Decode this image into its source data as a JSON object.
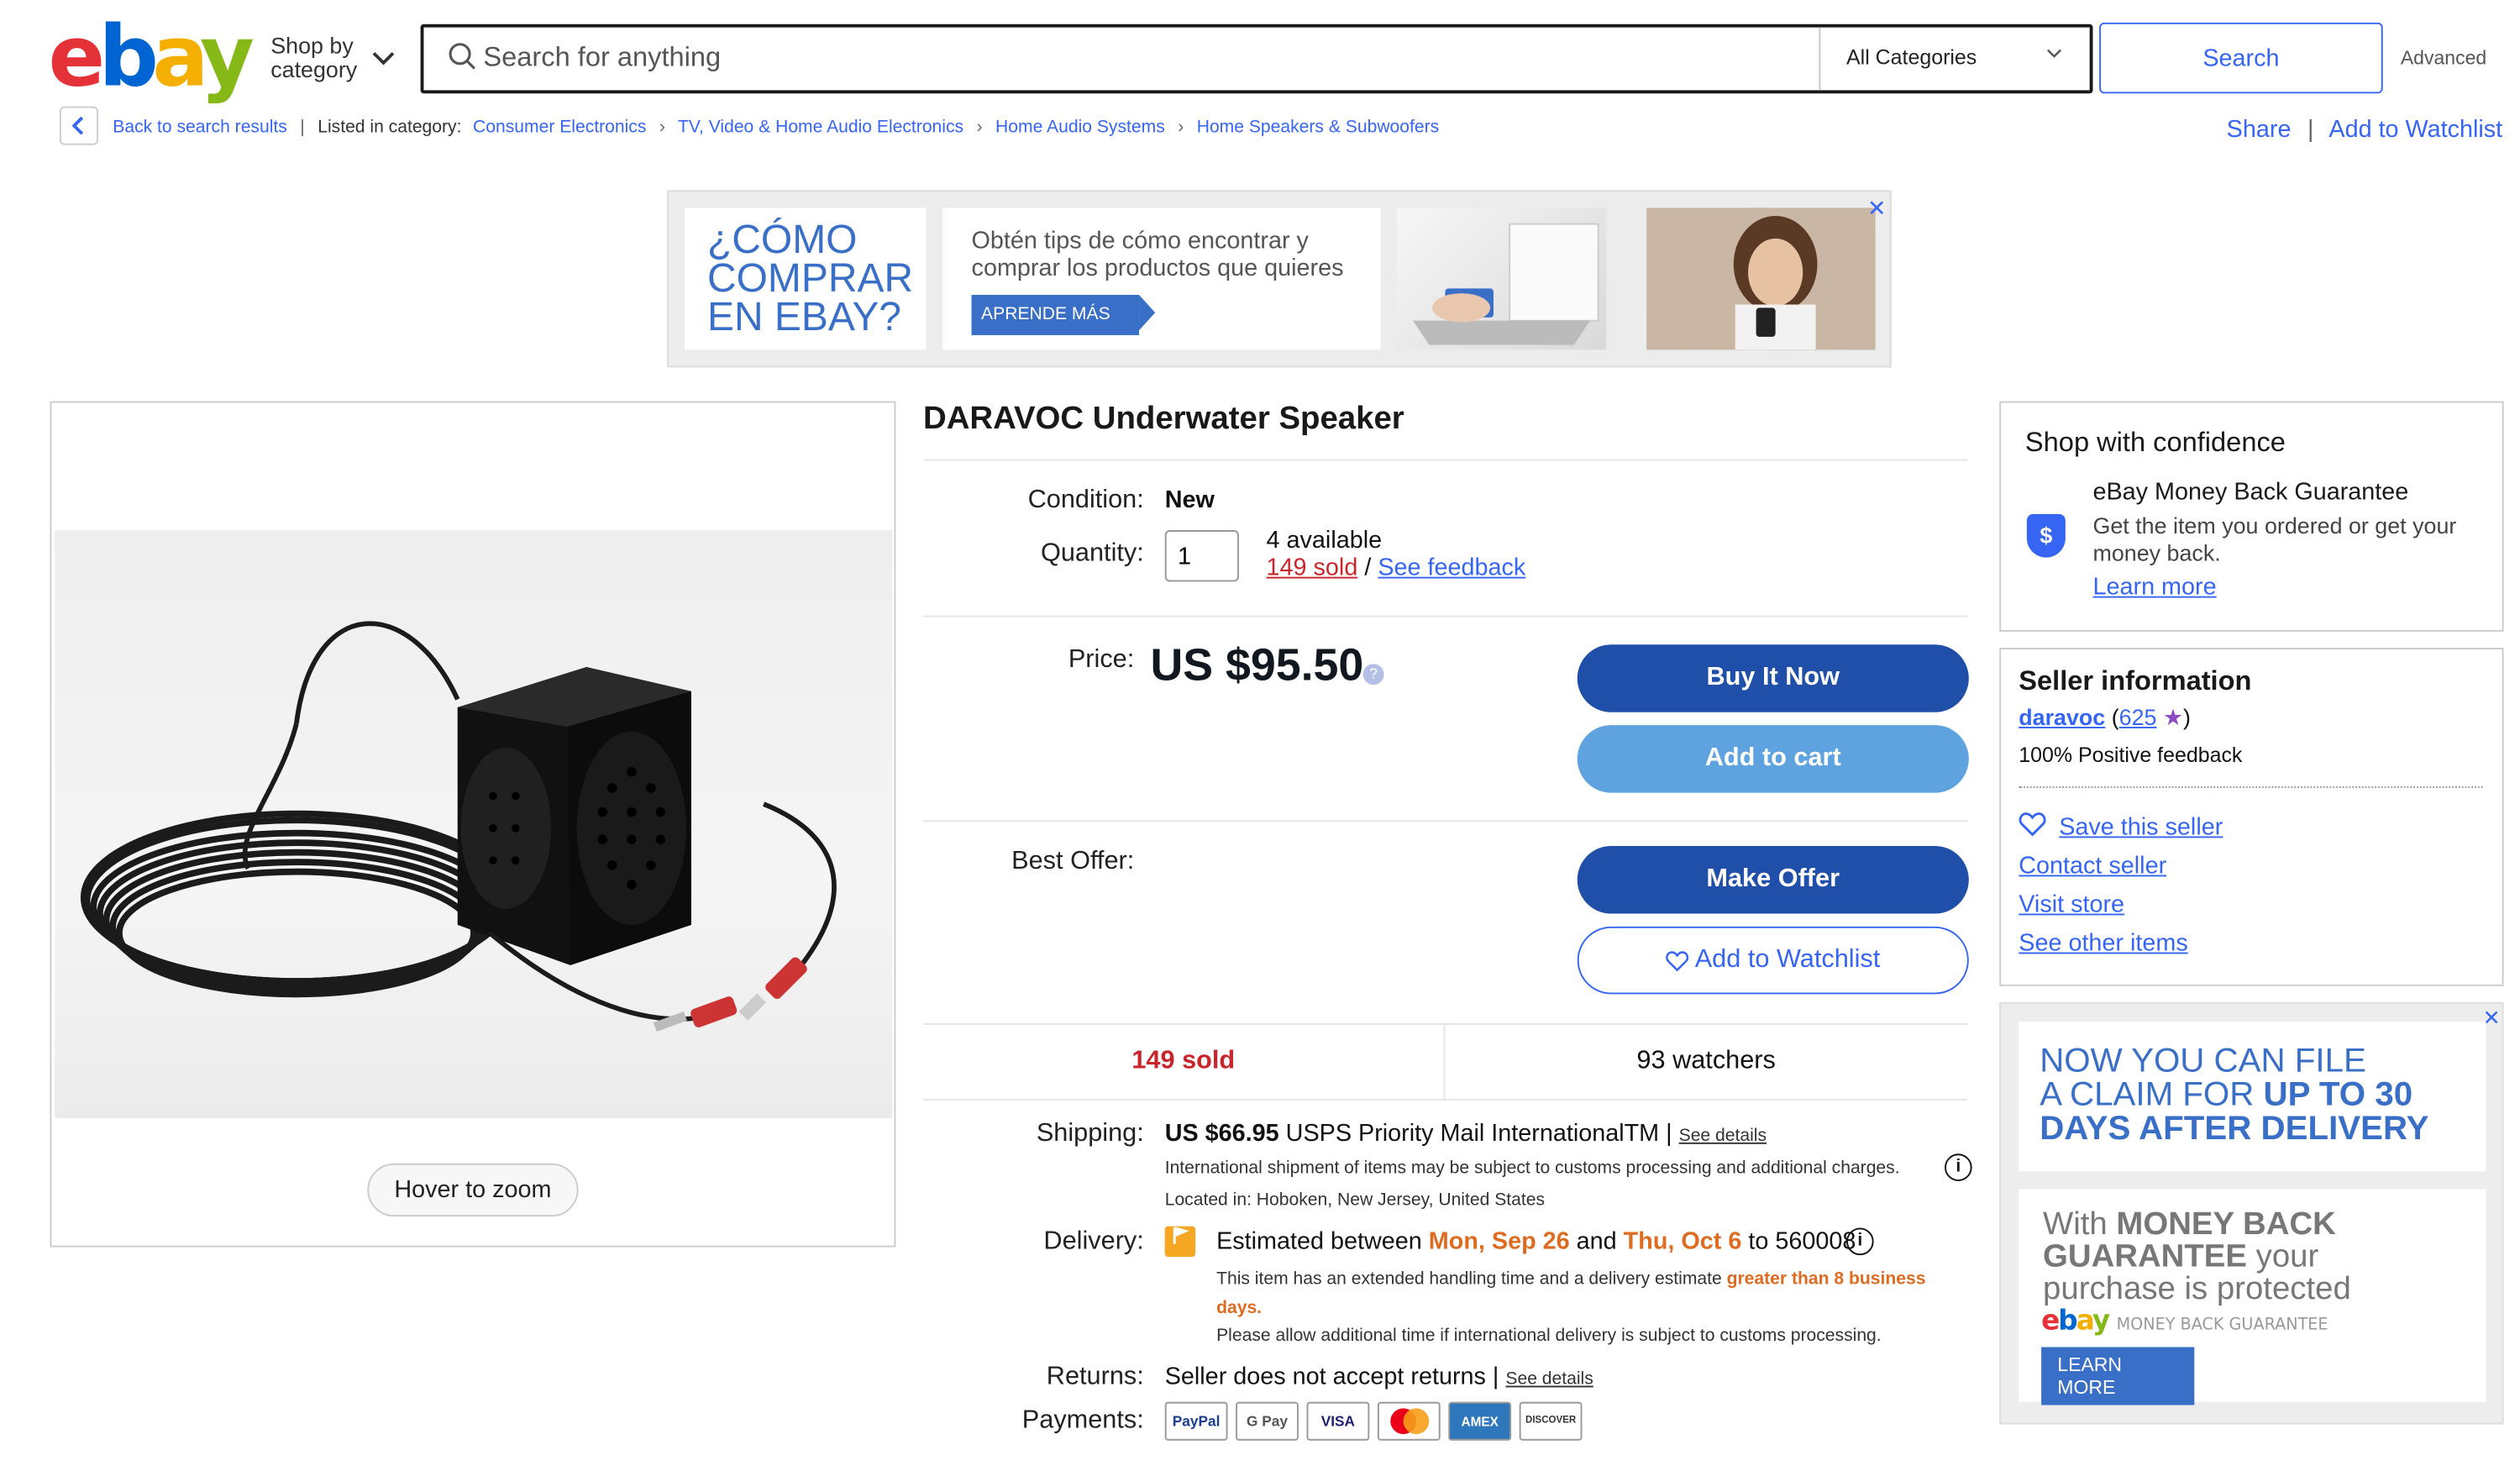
{
  "header": {
    "logo_letters": [
      "e",
      "b",
      "a",
      "y"
    ],
    "shop_by_category": "Shop by category",
    "search_placeholder": "Search for anything",
    "category_select": "All Categories",
    "search_button": "Search",
    "advanced": "Advanced"
  },
  "breadcrumb": {
    "back": "Back to search results",
    "listed_in": "Listed in category:",
    "items": [
      "Consumer Electronics",
      "TV, Video & Home Audio Electronics",
      "Home Audio Systems",
      "Home Speakers & Subwoofers"
    ],
    "share": "Share",
    "add_to_watchlist": "Add to Watchlist"
  },
  "ad_banner": {
    "headline": "¿CÓMO COMPRAR EN EBAY?",
    "tips": "Obtén tips de cómo encontrar y comprar los productos que quieres",
    "cta": "APRENDE MÁS",
    "close": "✕"
  },
  "image_panel": {
    "hover_to_zoom": "Hover to zoom"
  },
  "item": {
    "title": "DARAVOC Underwater Speaker",
    "condition_label": "Condition:",
    "condition": "New",
    "quantity_label": "Quantity:",
    "quantity_value": "1",
    "available": "4 available",
    "sold_link": "149 sold",
    "see_feedback": "See feedback",
    "price_label": "Price:",
    "price": "US $95.50",
    "buy_it_now": "Buy It Now",
    "add_to_cart": "Add to cart",
    "best_offer_label": "Best Offer:",
    "make_offer": "Make Offer",
    "add_to_watchlist": "Add to Watchlist",
    "sold_stat": "149 sold",
    "watchers_stat": "93 watchers",
    "shipping_label": "Shipping:",
    "shipping_price": "US $66.95",
    "shipping_method": " USPS Priority Mail InternationalTM | ",
    "see_details": "See details",
    "shipping_note": "International shipment of items may be subject to customs processing and additional charges.",
    "located_in": "Located in: Hoboken, New Jersey, United States",
    "delivery_label": "Delivery:",
    "delivery_estimated": "Estimated between ",
    "delivery_start": "Mon, Sep 26",
    "delivery_and": " and ",
    "delivery_end": "Thu, Oct 6",
    "delivery_to": " to 560008",
    "delivery_note_1": "This item has an extended handling time and a delivery estimate ",
    "delivery_note_highlight": "greater than 8 business days.",
    "delivery_note_2": "Please allow additional time if international delivery is subject to customs processing.",
    "returns_label": "Returns:",
    "returns_text": "Seller does not accept returns | ",
    "returns_see_details": "See details",
    "payments_label": "Payments:",
    "payment_methods": [
      "PayPal",
      "G Pay",
      "VISA",
      "mastercard",
      "AMEX",
      "DISCOVER"
    ]
  },
  "confidence": {
    "title": "Shop with confidence",
    "guarantee_title": "eBay Money Back Guarantee",
    "guarantee_text": "Get the item you ordered or get your money back.",
    "learn_more": "Learn more"
  },
  "seller": {
    "title": "Seller information",
    "name": "daravoc",
    "score": "625",
    "positive": "100% Positive feedback",
    "save_seller": "Save this seller",
    "contact": "Contact seller",
    "visit_store": "Visit store",
    "other_items": "See other items"
  },
  "right_ad": {
    "line1": "NOW YOU CAN FILE",
    "line2a": "A CLAIM FOR ",
    "line2b": "UP TO 30",
    "line3": "DAYS AFTER DELIVERY",
    "line4a": "With ",
    "line4b": "MONEY BACK",
    "line5a": "GUARANTEE",
    "line5b": " your",
    "line6": "purchase is protected",
    "brand": "MONEY BACK GUARANTEE",
    "cta": "LEARN MORE",
    "close": "✕"
  },
  "colors": {
    "ebay_red": "#e53238",
    "ebay_blue": "#0064d2",
    "ebay_yellow": "#f5af02",
    "ebay_green": "#86b817",
    "link_blue": "#3665f3",
    "button_dark_blue": "#1f4fa8",
    "button_light_blue": "#5ea3e0",
    "sold_red": "#c9262c",
    "delivery_orange": "#dd6b20"
  }
}
